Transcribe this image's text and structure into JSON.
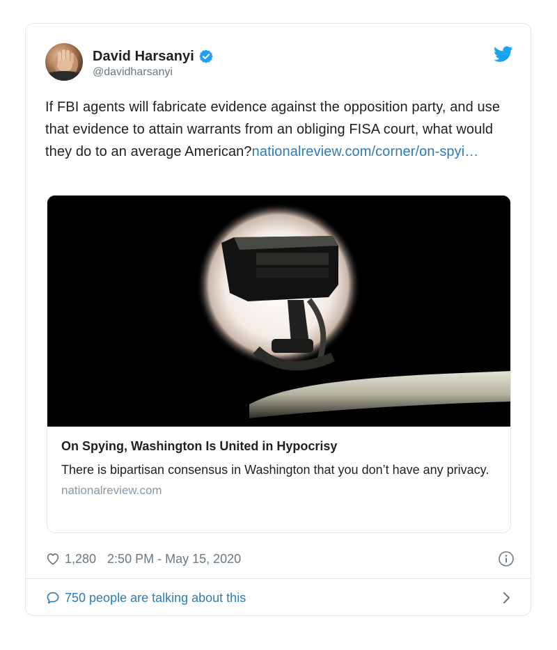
{
  "author": {
    "name": "David Harsanyi",
    "handle": "@davidharsanyi",
    "verified": true,
    "avatar_icon": "avatar-photo"
  },
  "tweet": {
    "text": "If FBI agents will fabricate evidence against the opposition party, and use that evidence to attain warrants from an obliging FISA court, what would they do to an average American?",
    "link_text": "nationalreview.com/corner/on-spyi…"
  },
  "card": {
    "image_icon": "surveillance-camera-image",
    "title": "On Spying, Washington Is United in Hypocrisy",
    "description": "There is bipartisan consensus in Washington that you don’t have any privacy.",
    "domain": "nationalreview.com"
  },
  "meta": {
    "likes": "1,280",
    "timestamp": "2:50 PM - May 15, 2020"
  },
  "conversation": {
    "label": "750 people are talking about this"
  },
  "colors": {
    "link": "#2b7bb9",
    "twitter_blue": "#1da1f2",
    "muted": "#697882",
    "border": "#e1e8ed"
  },
  "icons": {
    "brand": "twitter-bird-icon",
    "verified": "verified-badge-icon",
    "like": "heart-icon",
    "info": "info-icon",
    "reply": "speech-bubble-icon",
    "chevron": "chevron-right-icon"
  }
}
